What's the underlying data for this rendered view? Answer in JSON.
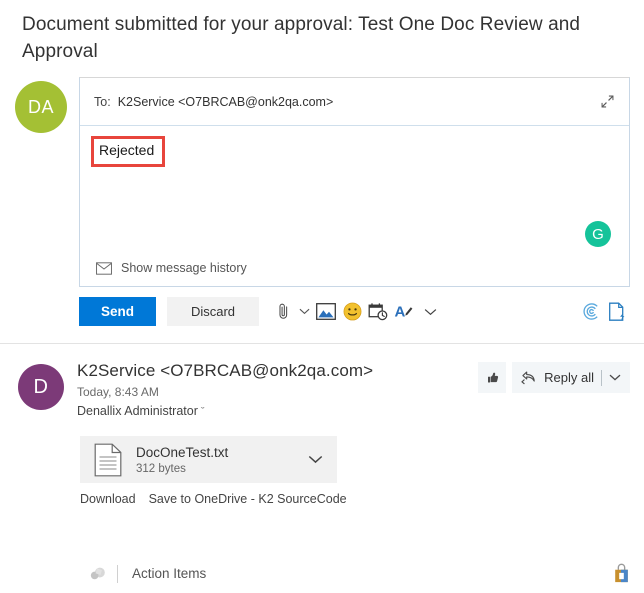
{
  "subject": "Document submitted for your approval: Test One Doc Review and Approval",
  "compose": {
    "avatar_initials": "DA",
    "to_label": "To:",
    "to_value": "K2Service <O7BRCAB@onk2qa.com>",
    "body_text": "Rejected",
    "show_history_label": "Show message history",
    "grammarly_glyph": "G",
    "expand_icon": "expand-icon",
    "highlight_color": "#e8453c"
  },
  "toolbar": {
    "send_label": "Send",
    "discard_label": "Discard",
    "accent_color": "#0078d7",
    "icons": [
      "attach-icon",
      "attach-chevron-down-icon",
      "insert-picture-icon",
      "emoji-icon",
      "schedule-icon",
      "font-color-icon",
      "more-options-chevron-down-icon"
    ],
    "right_icons": [
      "grammarly-tone-icon",
      "document-insights-icon"
    ]
  },
  "message": {
    "avatar_initials": "D",
    "sender": "K2Service <O7BRCAB@onk2qa.com>",
    "timestamp": "Today, 8:43 AM",
    "recipient": "Denallix Administrator",
    "recipient_chevron": "ˇ",
    "thumb_icon": "thumbs-up-icon",
    "reply_all_label": "Reply all",
    "reply_all_icon": "reply-all-icon",
    "reply_all_chevron": "chevron-down-icon"
  },
  "attachment": {
    "file_name": "DocOneTest.txt",
    "file_size": "312 bytes",
    "file_icon": "text-file-icon",
    "chevron": "chevron-down-icon",
    "download_label": "Download",
    "save_onedrive_label": "Save to OneDrive - K2 SourceCode"
  },
  "action_bar": {
    "app_icon": "app-cube-icon",
    "label": "Action Items",
    "right_icon": "secure-bag-lock-icon"
  }
}
